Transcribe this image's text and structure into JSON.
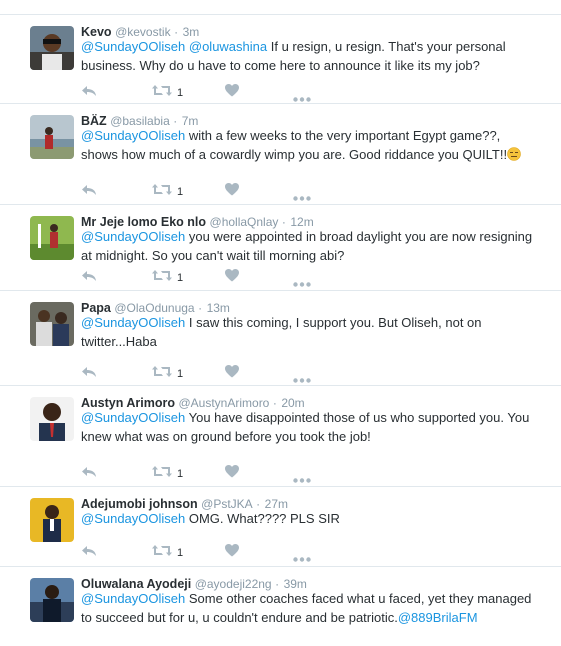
{
  "colors": {
    "link": "#1b95e0",
    "muted": "#8899a6",
    "text": "#292f33",
    "divider": "#e1e8ed",
    "icon": "#aab8c2"
  },
  "icons": {
    "reply": "reply-arrow-icon",
    "retweet": "retweet-icon",
    "like": "heart-icon",
    "more": "more-dots-icon"
  },
  "tweets": [
    {
      "name": "Kevo",
      "handle": "@kevostik",
      "sep": "·",
      "time": "3m",
      "parts": [
        {
          "text": "@SundayOOliseh",
          "link": true
        },
        {
          "text": " "
        },
        {
          "text": "@oluwashina",
          "link": true
        },
        {
          "text": " If u resign, u resign.  That's your personal business. Why do u have to come here to announce it like its my job?"
        }
      ],
      "retweets": "1"
    },
    {
      "name": "BÄZ",
      "handle": "@basilabia",
      "sep": "·",
      "time": "7m",
      "parts": [
        {
          "text": "@SundayOOliseh",
          "link": true
        },
        {
          "text": " with a few weeks to the very important Egypt game??, shows how much of a cowardly wimp you are. Good riddance you QUILT!!"
        }
      ],
      "emoji": "expressionless-face-emoji",
      "retweets": "1"
    },
    {
      "name": "Mr Jeje lomo Eko nlo",
      "handle": "@hollaQnlay",
      "sep": "·",
      "time": "12m",
      "parts": [
        {
          "text": "@SundayOOliseh",
          "link": true
        },
        {
          "text": " you were appointed in broad daylight you are now resigning at midnight. So you can't wait till morning abi?"
        }
      ],
      "retweets": "1"
    },
    {
      "name": "Papa",
      "handle": "@OlaOdunuga",
      "sep": "·",
      "time": "13m",
      "parts": [
        {
          "text": "@SundayOOliseh",
          "link": true
        },
        {
          "text": " I saw this coming, I support you. But Oliseh, not on twitter...Haba"
        }
      ],
      "retweets": "1"
    },
    {
      "name": "Austyn Arimoro",
      "handle": "@AustynArimoro",
      "sep": "·",
      "time": "20m",
      "parts": [
        {
          "text": "@SundayOOliseh",
          "link": true
        },
        {
          "text": " You have disappointed those of us who supported you. You knew what was on ground before you took the job!"
        }
      ],
      "retweets": "1"
    },
    {
      "name": "Adejumobi johnson",
      "handle": "@PstJKA",
      "sep": "·",
      "time": "27m",
      "parts": [
        {
          "text": "@SundayOOliseh",
          "link": true
        },
        {
          "text": " OMG. What???? PLS SIR"
        }
      ],
      "retweets": "1"
    },
    {
      "name": "Oluwalana Ayodeji",
      "handle": "@ayodeji22ng",
      "sep": "·",
      "time": "39m",
      "parts": [
        {
          "text": "@SundayOOliseh",
          "link": true
        },
        {
          "text": " Some other coaches faced what u faced, yet they managed to succeed but for u, u couldn't endure and be patriotic."
        },
        {
          "text": "@889BrilaFM",
          "link": true
        }
      ],
      "retweets": ""
    }
  ]
}
